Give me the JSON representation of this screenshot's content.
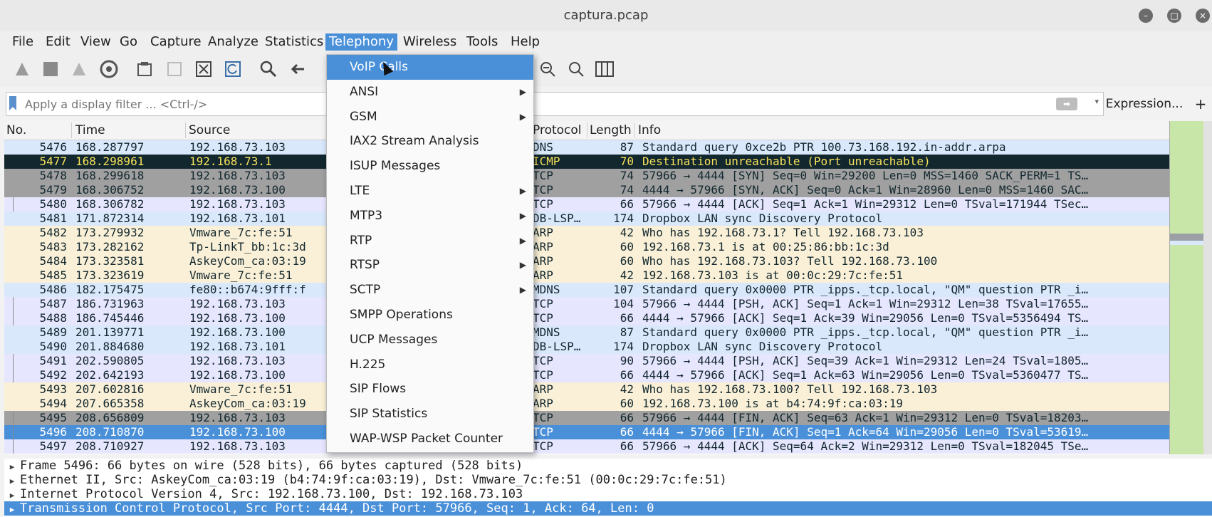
{
  "window": {
    "title": "captura.pcap"
  },
  "menubar": [
    "File",
    "Edit",
    "View",
    "Go",
    "Capture",
    "Analyze",
    "Statistics",
    "Telephony",
    "Wireless",
    "Tools",
    "Help"
  ],
  "filter": {
    "placeholder": "Apply a display filter ... <Ctrl-/>",
    "expression_label": "Expression...",
    "plus_label": "+"
  },
  "columns": {
    "no": "No.",
    "time": "Time",
    "source": "Source",
    "protocol": "Protocol",
    "length": "Length",
    "info": "Info"
  },
  "packets": [
    {
      "no": "5476",
      "time": "168.287797",
      "src": "192.168.73.103",
      "proto": "DNS",
      "len": "87",
      "info": "Standard query 0xce2b PTR 100.73.168.192.in-addr.arpa",
      "bg": "#dae8fc",
      "fg": "#12272e"
    },
    {
      "no": "5477",
      "time": "168.298961",
      "src": "192.168.73.1",
      "proto": "ICMP",
      "len": "70",
      "info": "Destination unreachable (Port unreachable)",
      "bg": "#12272e",
      "fg": "#f7e15a"
    },
    {
      "no": "5478",
      "time": "168.299618",
      "src": "192.168.73.103",
      "proto": "TCP",
      "len": "74",
      "info": "57966 → 4444 [SYN] Seq=0 Win=29200 Len=0 MSS=1460 SACK_PERM=1 TS…",
      "bg": "#a0a0a0",
      "fg": "#12272e"
    },
    {
      "no": "5479",
      "time": "168.306752",
      "src": "192.168.73.100",
      "proto": "TCP",
      "len": "74",
      "info": "4444 → 57966 [SYN, ACK] Seq=0 Ack=1 Win=28960 Len=0 MSS=1460 SAC…",
      "bg": "#a0a0a0",
      "fg": "#12272e"
    },
    {
      "no": "5480",
      "time": "168.306782",
      "src": "192.168.73.103",
      "proto": "TCP",
      "len": "66",
      "info": "57966 → 4444 [ACK] Seq=1 Ack=1 Win=29312 Len=0 TSval=171944 TSec…",
      "bg": "#e7e6ff",
      "fg": "#12272e"
    },
    {
      "no": "5481",
      "time": "171.872314",
      "src": "192.168.73.101",
      "proto": "DB-LSP…",
      "len": "174",
      "info": "Dropbox LAN sync Discovery Protocol",
      "bg": "#dae8fc",
      "fg": "#12272e"
    },
    {
      "no": "5482",
      "time": "173.279932",
      "src": "Vmware_7c:fe:51",
      "proto": "ARP",
      "len": "42",
      "info": "Who has 192.168.73.1? Tell 192.168.73.103",
      "bg": "#faf0d7",
      "fg": "#12272e"
    },
    {
      "no": "5483",
      "time": "173.282162",
      "src": "Tp-LinkT_bb:1c:3d",
      "proto": "ARP",
      "len": "60",
      "info": "192.168.73.1 is at 00:25:86:bb:1c:3d",
      "bg": "#faf0d7",
      "fg": "#12272e"
    },
    {
      "no": "5484",
      "time": "173.323581",
      "src": "AskeyCom_ca:03:19",
      "proto": "ARP",
      "len": "60",
      "info": "Who has 192.168.73.103? Tell 192.168.73.100",
      "bg": "#faf0d7",
      "fg": "#12272e"
    },
    {
      "no": "5485",
      "time": "173.323619",
      "src": "Vmware_7c:fe:51",
      "proto": "ARP",
      "len": "42",
      "info": "192.168.73.103 is at 00:0c:29:7c:fe:51",
      "bg": "#faf0d7",
      "fg": "#12272e"
    },
    {
      "no": "5486",
      "time": "182.175475",
      "src": "fe80::b674:9fff:f",
      "proto": "MDNS",
      "len": "107",
      "info": "Standard query 0x0000 PTR _ipps._tcp.local, \"QM\" question PTR _i…",
      "bg": "#dae8fc",
      "fg": "#12272e"
    },
    {
      "no": "5487",
      "time": "186.731963",
      "src": "192.168.73.103",
      "proto": "TCP",
      "len": "104",
      "info": "57966 → 4444 [PSH, ACK] Seq=1 Ack=1 Win=29312 Len=38 TSval=17655…",
      "bg": "#e7e6ff",
      "fg": "#12272e"
    },
    {
      "no": "5488",
      "time": "186.745446",
      "src": "192.168.73.100",
      "proto": "TCP",
      "len": "66",
      "info": "4444 → 57966 [ACK] Seq=1 Ack=39 Win=29056 Len=0 TSval=5356494 TS…",
      "bg": "#e7e6ff",
      "fg": "#12272e"
    },
    {
      "no": "5489",
      "time": "201.139771",
      "src": "192.168.73.100",
      "proto": "MDNS",
      "len": "87",
      "info": "Standard query 0x0000 PTR _ipps._tcp.local, \"QM\" question PTR _i…",
      "bg": "#dae8fc",
      "fg": "#12272e"
    },
    {
      "no": "5490",
      "time": "201.884680",
      "src": "192.168.73.101",
      "proto": "DB-LSP…",
      "len": "174",
      "info": "Dropbox LAN sync Discovery Protocol",
      "bg": "#dae8fc",
      "fg": "#12272e"
    },
    {
      "no": "5491",
      "time": "202.590805",
      "src": "192.168.73.103",
      "proto": "TCP",
      "len": "90",
      "info": "57966 → 4444 [PSH, ACK] Seq=39 Ack=1 Win=29312 Len=24 TSval=1805…",
      "bg": "#e7e6ff",
      "fg": "#12272e"
    },
    {
      "no": "5492",
      "time": "202.642193",
      "src": "192.168.73.100",
      "proto": "TCP",
      "len": "66",
      "info": "4444 → 57966 [ACK] Seq=1 Ack=63 Win=29056 Len=0 TSval=5360477 TS…",
      "bg": "#e7e6ff",
      "fg": "#12272e"
    },
    {
      "no": "5493",
      "time": "207.602816",
      "src": "Vmware_7c:fe:51",
      "proto": "ARP",
      "len": "42",
      "info": "Who has 192.168.73.100? Tell 192.168.73.103",
      "bg": "#faf0d7",
      "fg": "#12272e"
    },
    {
      "no": "5494",
      "time": "207.665358",
      "src": "AskeyCom_ca:03:19",
      "proto": "ARP",
      "len": "60",
      "info": "192.168.73.100 is at b4:74:9f:ca:03:19",
      "bg": "#faf0d7",
      "fg": "#12272e"
    },
    {
      "no": "5495",
      "time": "208.656809",
      "src": "192.168.73.103",
      "proto": "TCP",
      "len": "66",
      "info": "57966 → 4444 [FIN, ACK] Seq=63 Ack=1 Win=29312 Len=0 TSval=18203…",
      "bg": "#a0a0a0",
      "fg": "#12272e"
    },
    {
      "no": "5496",
      "time": "208.710870",
      "src": "192.168.73.100",
      "proto": "TCP",
      "len": "66",
      "info": "4444 → 57966 [FIN, ACK] Seq=1 Ack=64 Win=29056 Len=0 TSval=53619…",
      "bg": "#4a90d9",
      "fg": "#ffffff"
    },
    {
      "no": "5497",
      "time": "208.710927",
      "src": "192.168.73.103",
      "proto": "TCP",
      "len": "66",
      "info": "57966 → 4444 [ACK] Seq=64 Ack=2 Win=29312 Len=0 TSval=182045 TSe…",
      "bg": "#e7e6ff",
      "fg": "#12272e"
    }
  ],
  "details": [
    {
      "text": "Frame 5496: 66 bytes on wire (528 bits), 66 bytes captured (528 bits)",
      "selected": false
    },
    {
      "text": "Ethernet II, Src: AskeyCom_ca:03:19 (b4:74:9f:ca:03:19), Dst: Vmware_7c:fe:51 (00:0c:29:7c:fe:51)",
      "selected": false
    },
    {
      "text": "Internet Protocol Version 4, Src: 192.168.73.100, Dst: 192.168.73.103",
      "selected": false
    },
    {
      "text": "Transmission Control Protocol, Src Port: 4444, Dst Port: 57966, Seq: 1, Ack: 64, Len: 0",
      "selected": true
    }
  ],
  "telephony_menu": [
    {
      "label": "VoIP Calls",
      "submenu": false,
      "highlighted": true
    },
    {
      "label": "ANSI",
      "submenu": true
    },
    {
      "label": "GSM",
      "submenu": true
    },
    {
      "label": "IAX2 Stream Analysis",
      "submenu": false
    },
    {
      "label": "ISUP Messages",
      "submenu": false
    },
    {
      "label": "LTE",
      "submenu": true
    },
    {
      "label": "MTP3",
      "submenu": true
    },
    {
      "label": "RTP",
      "submenu": true
    },
    {
      "label": "RTSP",
      "submenu": true
    },
    {
      "label": "SCTP",
      "submenu": true
    },
    {
      "label": "SMPP Operations",
      "submenu": false
    },
    {
      "label": "UCP Messages",
      "submenu": false
    },
    {
      "label": "H.225",
      "submenu": false
    },
    {
      "label": "SIP Flows",
      "submenu": false
    },
    {
      "label": "SIP Statistics",
      "submenu": false
    },
    {
      "label": "WAP-WSP Packet Counter",
      "submenu": false
    }
  ],
  "colors": {
    "accent": "#4a90d9"
  }
}
